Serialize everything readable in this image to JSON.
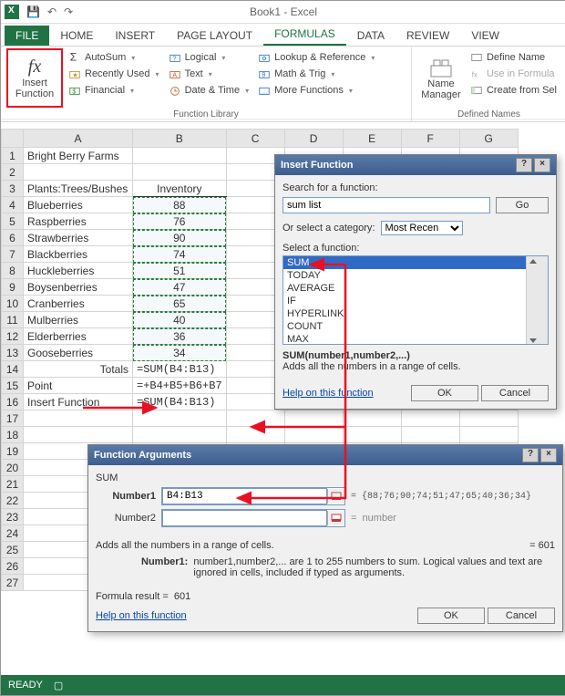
{
  "app": {
    "title": "Book1 - Excel"
  },
  "tabs": [
    "FILE",
    "HOME",
    "INSERT",
    "PAGE LAYOUT",
    "FORMULAS",
    "DATA",
    "REVIEW",
    "VIEW"
  ],
  "ribbon": {
    "insert_function": "Insert\nFunction",
    "c1": [
      "AutoSum",
      "Recently Used",
      "Financial"
    ],
    "c2": [
      "Logical",
      "Text",
      "Date & Time"
    ],
    "c3": [
      "Lookup & Reference",
      "Math & Trig",
      "More Functions"
    ],
    "grp1_label": "Function Library",
    "name_manager": "Name\nManager",
    "defnames": [
      "Define Name",
      "Use in Formula",
      "Create from Sel"
    ],
    "grp2_label": "Defined Names"
  },
  "grid": {
    "a1": "Bright Berry Farms",
    "a3": "Plants:Trees/Bushes",
    "b3": "Inventory",
    "items": [
      {
        "name": "Blueberries",
        "qty": 88
      },
      {
        "name": "Raspberries",
        "qty": 76
      },
      {
        "name": "Strawberries",
        "qty": 90
      },
      {
        "name": "Blackberries",
        "qty": 74
      },
      {
        "name": "Huckleberries",
        "qty": 51
      },
      {
        "name": "Boysenberries",
        "qty": 47
      },
      {
        "name": "Cranberries",
        "qty": 65
      },
      {
        "name": "Mulberries",
        "qty": 40
      },
      {
        "name": "Elderberries",
        "qty": 36
      },
      {
        "name": "Gooseberries",
        "qty": 34
      }
    ],
    "totals_label": "Totals",
    "b14": "=SUM(B4:B13)",
    "a15": "Point",
    "b15": "=+B4+B5+B6+B7",
    "a16": "Insert Function",
    "b16": "=SUM(B4:B13)"
  },
  "insert_dlg": {
    "title": "Insert Function",
    "search_label": "Search for a function:",
    "search_value": "sum list",
    "go": "Go",
    "category_label": "Or select a category:",
    "category_value": "Most Recen",
    "select_label": "Select a function:",
    "functions": [
      "SUM",
      "TODAY",
      "AVERAGE",
      "IF",
      "HYPERLINK",
      "COUNT",
      "MAX"
    ],
    "syntax": "SUM(number1,number2,...)",
    "desc": "Adds all the numbers in a range of cells.",
    "help": "Help on this function",
    "ok": "OK",
    "cancel": "Cancel"
  },
  "args_dlg": {
    "title": "Function Arguments",
    "fn": "SUM",
    "n1_label": "Number1",
    "n1_value": "B4:B13",
    "n1_preview": "{88;76;90;74;51;47;65;40;36;34}",
    "n2_label": "Number2",
    "n2_placeholder": "number",
    "desc": "Adds all the numbers in a range of cells.",
    "result_inline": "= 601",
    "arg_help_label": "Number1:",
    "arg_help": "number1,number2,... are 1 to 255 numbers to sum. Logical values and text are ignored in cells, included if typed as arguments.",
    "formula_result_label": "Formula result =",
    "formula_result": "601",
    "help": "Help on this function",
    "ok": "OK",
    "cancel": "Cancel"
  },
  "status": {
    "ready": "READY"
  },
  "chart_data": {
    "type": "table",
    "title": "Bright Berry Farms Inventory",
    "columns": [
      "Plants:Trees/Bushes",
      "Inventory"
    ],
    "rows": [
      [
        "Blueberries",
        88
      ],
      [
        "Raspberries",
        76
      ],
      [
        "Strawberries",
        90
      ],
      [
        "Blackberries",
        74
      ],
      [
        "Huckleberries",
        51
      ],
      [
        "Boysenberries",
        47
      ],
      [
        "Cranberries",
        65
      ],
      [
        "Mulberries",
        40
      ],
      [
        "Elderberries",
        36
      ],
      [
        "Gooseberries",
        34
      ]
    ],
    "total": 601
  }
}
